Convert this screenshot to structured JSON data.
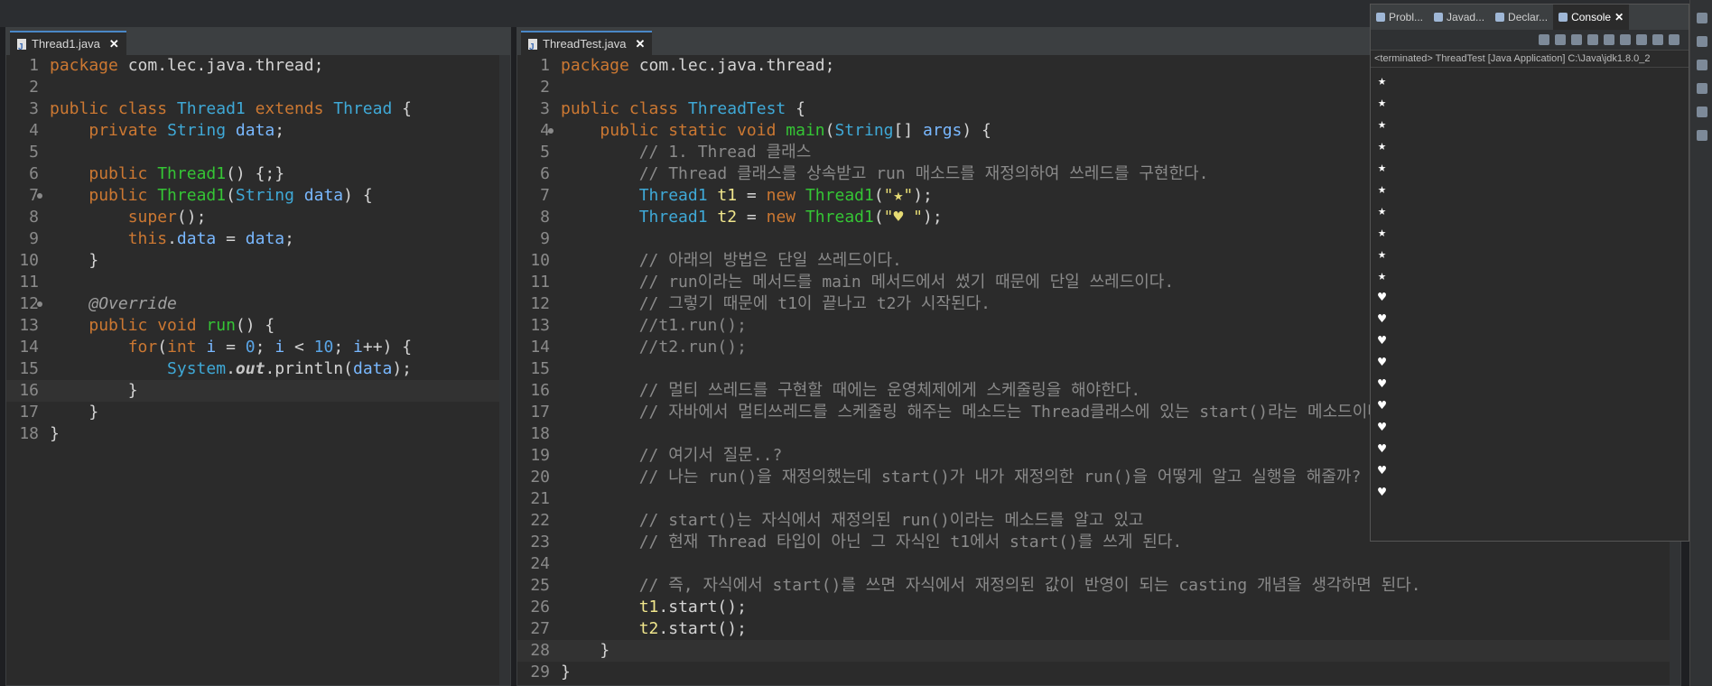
{
  "editor1": {
    "tab": "Thread1.java",
    "current_line": 16,
    "lines": [
      {
        "n": "1",
        "t": [
          [
            "k",
            "package "
          ],
          [
            "src",
            "com.lec.java.thread;"
          ]
        ]
      },
      {
        "n": "2",
        "t": []
      },
      {
        "n": "3",
        "t": [
          [
            "k",
            "public class "
          ],
          [
            "ty",
            "Thread1 "
          ],
          [
            "k",
            "extends "
          ],
          [
            "ty",
            "Thread "
          ],
          [
            "src",
            "{"
          ]
        ]
      },
      {
        "n": "4",
        "t": [
          [
            "src",
            "    "
          ],
          [
            "k",
            "private "
          ],
          [
            "ty",
            "String "
          ],
          [
            "vr",
            "data"
          ],
          [
            "src",
            ";"
          ]
        ]
      },
      {
        "n": "5",
        "t": []
      },
      {
        "n": "6",
        "t": [
          [
            "src",
            "    "
          ],
          [
            "k",
            "public "
          ],
          [
            "fn",
            "Thread1"
          ],
          [
            "src",
            "() {;}"
          ]
        ]
      },
      {
        "n": "7",
        "m": "fold",
        "t": [
          [
            "src",
            "    "
          ],
          [
            "k",
            "public "
          ],
          [
            "fn",
            "Thread1"
          ],
          [
            "src",
            "("
          ],
          [
            "ty",
            "String "
          ],
          [
            "vr",
            "data"
          ],
          [
            "src",
            ") {"
          ]
        ]
      },
      {
        "n": "8",
        "t": [
          [
            "src",
            "        "
          ],
          [
            "k",
            "super"
          ],
          [
            "src",
            "();"
          ]
        ]
      },
      {
        "n": "9",
        "t": [
          [
            "src",
            "        "
          ],
          [
            "k",
            "this"
          ],
          [
            "src",
            "."
          ],
          [
            "vr",
            "data"
          ],
          [
            "src",
            " = "
          ],
          [
            "vr",
            "data"
          ],
          [
            "src",
            ";"
          ]
        ]
      },
      {
        "n": "10",
        "t": [
          [
            "src",
            "    }"
          ]
        ]
      },
      {
        "n": "11",
        "t": []
      },
      {
        "n": "12",
        "m": "fold",
        "t": [
          [
            "src",
            "    "
          ],
          [
            "an",
            "@Override"
          ]
        ]
      },
      {
        "n": "13",
        "t": [
          [
            "src",
            "    "
          ],
          [
            "k",
            "public void "
          ],
          [
            "fn",
            "run"
          ],
          [
            "src",
            "() {"
          ]
        ]
      },
      {
        "n": "14",
        "t": [
          [
            "src",
            "        "
          ],
          [
            "k",
            "for"
          ],
          [
            "src",
            "("
          ],
          [
            "k",
            "int "
          ],
          [
            "vr",
            "i"
          ],
          [
            "src",
            " = "
          ],
          [
            "nm",
            "0"
          ],
          [
            "src",
            "; "
          ],
          [
            "vr",
            "i"
          ],
          [
            "src",
            " < "
          ],
          [
            "nm",
            "10"
          ],
          [
            "src",
            "; "
          ],
          [
            "vr",
            "i"
          ],
          [
            "src",
            "++) {"
          ]
        ]
      },
      {
        "n": "15",
        "t": [
          [
            "src",
            "            "
          ],
          [
            "ty",
            "System"
          ],
          [
            "src",
            "."
          ],
          [
            "it",
            "out"
          ],
          [
            "src",
            ".println("
          ],
          [
            "vr",
            "data"
          ],
          [
            "src",
            ");"
          ]
        ]
      },
      {
        "n": "16",
        "t": [
          [
            "src",
            "        }"
          ]
        ]
      },
      {
        "n": "17",
        "t": [
          [
            "src",
            "    }"
          ]
        ]
      },
      {
        "n": "18",
        "t": [
          [
            "src",
            "}"
          ]
        ]
      }
    ]
  },
  "editor2": {
    "tab": "ThreadTest.java",
    "current_line": 28,
    "lines": [
      {
        "n": "1",
        "t": [
          [
            "k",
            "package "
          ],
          [
            "src",
            "com.lec.java.thread;"
          ]
        ]
      },
      {
        "n": "2",
        "t": []
      },
      {
        "n": "3",
        "t": [
          [
            "k",
            "public class "
          ],
          [
            "ty",
            "ThreadTest "
          ],
          [
            "src",
            "{"
          ]
        ]
      },
      {
        "n": "4",
        "m": "fold",
        "t": [
          [
            "src",
            "    "
          ],
          [
            "k",
            "public static void "
          ],
          [
            "fn",
            "main"
          ],
          [
            "src",
            "("
          ],
          [
            "ty",
            "String"
          ],
          [
            "src",
            "[] "
          ],
          [
            "vr",
            "args"
          ],
          [
            "src",
            ") {"
          ]
        ]
      },
      {
        "n": "5",
        "t": [
          [
            "src",
            "        "
          ],
          [
            "cm",
            "// 1. Thread 클래스"
          ]
        ]
      },
      {
        "n": "6",
        "t": [
          [
            "src",
            "        "
          ],
          [
            "cm",
            "// Thread 클래스를 상속받고 run 매소드를 재정의하여 쓰레드를 구현한다."
          ]
        ]
      },
      {
        "n": "7",
        "t": [
          [
            "src",
            "        "
          ],
          [
            "ty",
            "Thread1 "
          ],
          [
            "tv",
            "t1"
          ],
          [
            "src",
            " = "
          ],
          [
            "k",
            "new "
          ],
          [
            "fn",
            "Thread1"
          ],
          [
            "src",
            "("
          ],
          [
            "st",
            "\"★\""
          ],
          [
            "src",
            ");"
          ]
        ]
      },
      {
        "n": "8",
        "t": [
          [
            "src",
            "        "
          ],
          [
            "ty",
            "Thread1 "
          ],
          [
            "tv",
            "t2"
          ],
          [
            "src",
            " = "
          ],
          [
            "k",
            "new "
          ],
          [
            "fn",
            "Thread1"
          ],
          [
            "src",
            "("
          ],
          [
            "st",
            "\"♥ \""
          ],
          [
            "src",
            ");"
          ]
        ]
      },
      {
        "n": "9",
        "t": []
      },
      {
        "n": "10",
        "t": [
          [
            "src",
            "        "
          ],
          [
            "cm",
            "// 아래의 방법은 단일 쓰레드이다."
          ]
        ]
      },
      {
        "n": "11",
        "t": [
          [
            "src",
            "        "
          ],
          [
            "cm",
            "// run이라는 메서드를 main 메서드에서 썼기 때문에 단일 쓰레드이다."
          ]
        ]
      },
      {
        "n": "12",
        "t": [
          [
            "src",
            "        "
          ],
          [
            "cm",
            "// 그렇기 때문에 t1이 끝나고 t2가 시작된다."
          ]
        ]
      },
      {
        "n": "13",
        "t": [
          [
            "src",
            "        "
          ],
          [
            "cm",
            "//t1.run();"
          ]
        ]
      },
      {
        "n": "14",
        "t": [
          [
            "src",
            "        "
          ],
          [
            "cm",
            "//t2.run();"
          ]
        ]
      },
      {
        "n": "15",
        "t": []
      },
      {
        "n": "16",
        "t": [
          [
            "src",
            "        "
          ],
          [
            "cm",
            "// 멀티 쓰레드를 구현할 때에는 운영체제에게 스케줄링을 해야한다."
          ]
        ]
      },
      {
        "n": "17",
        "t": [
          [
            "src",
            "        "
          ],
          [
            "cm",
            "// 자바에서 멀티쓰레드를 스케줄링 해주는 메소드는 Thread클래스에 있는 start()라는 메소드이다."
          ]
        ]
      },
      {
        "n": "18",
        "t": []
      },
      {
        "n": "19",
        "t": [
          [
            "src",
            "        "
          ],
          [
            "cm",
            "// 여기서 질문..?"
          ]
        ]
      },
      {
        "n": "20",
        "t": [
          [
            "src",
            "        "
          ],
          [
            "cm",
            "// 나는 run()을 재정의했는데 start()가 내가 재정의한 run()을 어떻게 알고 실행을 해줄까?"
          ]
        ]
      },
      {
        "n": "21",
        "t": []
      },
      {
        "n": "22",
        "t": [
          [
            "src",
            "        "
          ],
          [
            "cm",
            "// start()는 자식에서 재정의된 run()이라는 메소드를 알고 있고"
          ]
        ]
      },
      {
        "n": "23",
        "t": [
          [
            "src",
            "        "
          ],
          [
            "cm",
            "// 현재 Thread 타입이 아닌 그 자식인 t1에서 start()를 쓰게 된다."
          ]
        ]
      },
      {
        "n": "24",
        "t": []
      },
      {
        "n": "25",
        "t": [
          [
            "src",
            "        "
          ],
          [
            "cm",
            "// 즉, 자식에서 start()를 쓰면 자식에서 재정의된 값이 반영이 되는 casting 개념을 생각하면 된다."
          ]
        ]
      },
      {
        "n": "26",
        "t": [
          [
            "src",
            "        "
          ],
          [
            "tv",
            "t1"
          ],
          [
            "src",
            ".start();"
          ]
        ]
      },
      {
        "n": "27",
        "t": [
          [
            "src",
            "        "
          ],
          [
            "tv",
            "t2"
          ],
          [
            "src",
            ".start();"
          ]
        ]
      },
      {
        "n": "28",
        "t": [
          [
            "src",
            "    }"
          ]
        ]
      },
      {
        "n": "29",
        "t": [
          [
            "src",
            "}"
          ]
        ]
      }
    ]
  },
  "console": {
    "tabs": [
      {
        "label": "Probl...",
        "icon": "problems-icon"
      },
      {
        "label": "Javad...",
        "icon": "javadoc-icon"
      },
      {
        "label": "Declar...",
        "icon": "declaration-icon"
      },
      {
        "label": "Console",
        "icon": "console-icon",
        "active": true
      }
    ],
    "status": "<terminated> ThreadTest [Java Application] C:\\Java\\jdk1.8.0_2",
    "output": [
      "★",
      "★",
      "★",
      "★",
      "★",
      "★",
      "★",
      "★",
      "★",
      "★",
      "♥",
      "♥",
      "♥",
      "♥",
      "♥",
      "♥",
      "♥",
      "♥",
      "♥",
      "♥"
    ]
  },
  "close_glyph": "✕"
}
